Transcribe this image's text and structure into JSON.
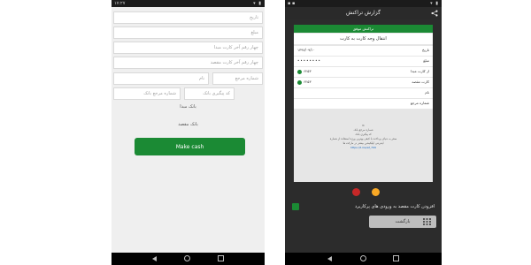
{
  "left_phone": {
    "status_time": "۱۷:۲۷",
    "fields": {
      "date": "تاریخ",
      "amount": "مبلغ",
      "source_card_last4": "چهار رقم آخر کارت مبدا",
      "dest_card_last4": "چهار رقم آخر کارت مقصد",
      "name": "نام",
      "reference_number": "شماره مرجع",
      "bank_tracking_code": "کد پیگیری بانک",
      "bank_reference_number": "شماره مرجع بانک"
    },
    "source_bank_label": "بانک مبدا",
    "dest_bank_label": "بانک مقصد",
    "make_cash_label": "Make cash"
  },
  "right_phone": {
    "title": "گزارش تراکنش",
    "receipt_header": "تراکنش موفق",
    "receipt_subtitle": "انتقال وجه کارت به کارت",
    "rows": {
      "date_label": "تاریخ",
      "date_value": "۱۳۹۷/۰۹/۱۰",
      "amount_label": "مبلغ",
      "amount_dots": "••••••••",
      "source_label": "از کارت مبدا",
      "source_value": "۶۲۵۳",
      "dest_label": "کارت مقصد",
      "dest_value": "۶۲۵۳",
      "name_label": "نام",
      "ref_label": "شماره مرجع"
    },
    "note_line_1": "شماره مرجع بانک",
    "note_line_2": "کد پیگیری بانک",
    "note_line_3": "سفر به دنیای پرداخت با کیفی بهترین ورژه استفاده از شماره",
    "note_line_4": "اینترنتی اپلیکیشن بیشتر در مارکت ها",
    "note_link": "https://t.me/af_799",
    "info_text": "افزودن کارت مقصد به ورودی های پرکاربرد",
    "back_label": "بازگشت",
    "colors": {
      "accent": "#1b8a34",
      "link": "#1565c0"
    }
  }
}
